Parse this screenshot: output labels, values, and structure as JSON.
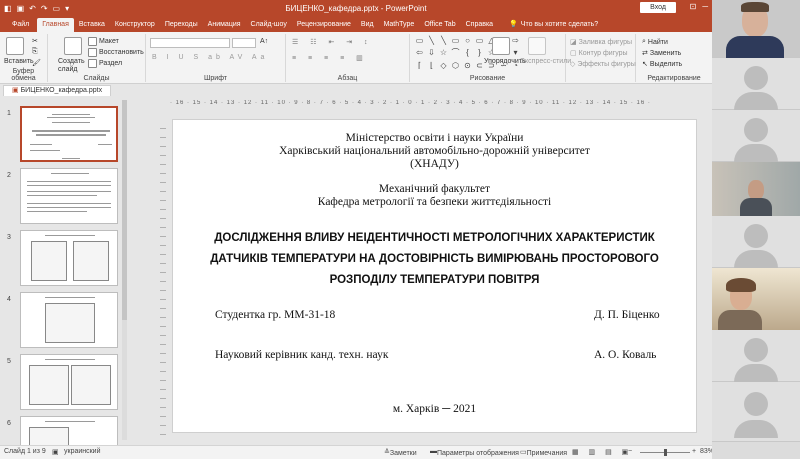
{
  "app": {
    "window_title": "БИЦЕНКО_кафедра.pptx  -  PowerPoint",
    "login_button": "Вход",
    "file_tab": "БИЦЕНКО_кафедра.pptx"
  },
  "ribbon_tabs": [
    "Файл",
    "Главная",
    "Вставка",
    "Конструктор",
    "Переходы",
    "Анимация",
    "Слайд-шоу",
    "Рецензирование",
    "Вид",
    "MathType",
    "Office Tab",
    "Справка"
  ],
  "search_prompt": "Что вы хотите сделать?",
  "ribbon": {
    "paste": "Вставить",
    "clipboard_group": "Буфер обмена",
    "new_slide": "Создать слайд",
    "layout": "Макет",
    "reset": "Восстановить",
    "section": "Раздел",
    "slides_group": "Слайды",
    "font_group": "Шрифт",
    "paragraph_group": "Абзац",
    "arrange": "Упорядочить",
    "quick_styles": "Экспресс-стили",
    "shape_fill": "Заливка фигуры",
    "shape_outline": "Контур фигуры",
    "shape_effects": "Эффекты фигуры",
    "drawing_group": "Рисование",
    "find": "Найти",
    "replace": "Заменить",
    "select": "Выделить",
    "editing_group": "Редактирование"
  },
  "ruler_text": "· 16 · 15 · 14 · 13 · 12 · 11 · 10 · 9 · 8 · 7 · 6 · 5 · 4 · 3 · 2 · 1 · 0 · 1 · 2 · 3 · 4 · 5 · 6 · 7 · 8 · 9 · 10 · 11 · 12 · 13 · 14 · 15 · 16 ·",
  "thumbnails": [
    "1",
    "2",
    "3",
    "4",
    "5",
    "6"
  ],
  "slide": {
    "ministry": "Міністерство освіти і науки України",
    "university": "Харківський національний автомобільно-дорожній університет",
    "abbr": "(ХНАДУ)",
    "faculty": "Механічний факультет",
    "department": "Кафедра метрології та безпеки життєдіяльності",
    "title_line1": "ДОСЛІДЖЕННЯ ВЛИВУ НЕІДЕНТИЧНОСТІ МЕТРОЛОГІЧНИХ ХАРАКТЕРИСТИК",
    "title_line2": "ДАТЧИКІВ ТЕМПЕРАТУРИ НА ДОСТОВІРНІСТЬ ВИМІРЮВАНЬ ПРОСТОРОВОГО",
    "title_line3": "РОЗПОДІЛУ ТЕМПЕРАТУРИ ПОВІТРЯ",
    "student_label": "Студентка гр. ММ-31-18",
    "student_name": "Д. П. Біценко",
    "advisor_label": "Науковий керівник канд. техн. наук",
    "advisor_name": "А. О. Коваль",
    "city_year": "м. Харків ─ 2021"
  },
  "status": {
    "slide_of": "Слайд 1 из 9",
    "language": "украинский",
    "notes": "Заметки",
    "display_params": "Параметры отображения",
    "comments": "Примечания",
    "zoom": "83%"
  },
  "colors": {
    "accent": "#b7472a",
    "ribbon_bg": "#f3f3f3",
    "workspace": "#e6e6e6"
  }
}
